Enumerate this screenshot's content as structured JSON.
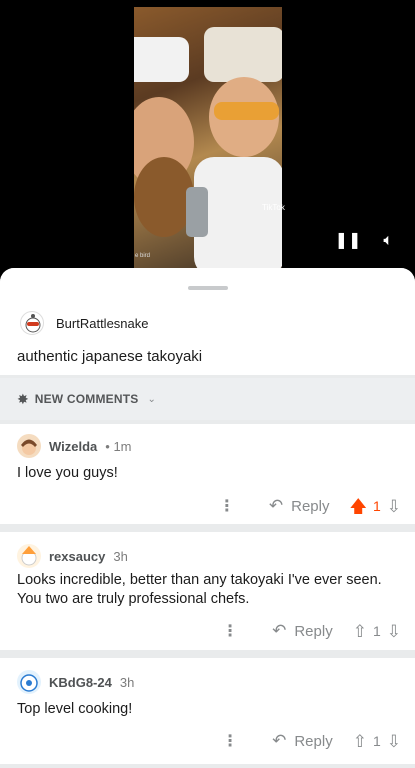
{
  "video": {
    "watermark": "TikTok",
    "cam_tag": "e bird",
    "pause_icon": "pause-icon",
    "volume_icon": "volume-icon"
  },
  "post": {
    "author": "BurtRattlesnake",
    "title": "authentic japanese takoyaki"
  },
  "new_comments": {
    "label": "NEW COMMENTS"
  },
  "comments": [
    {
      "user": "Wizelda",
      "time": "• 1m",
      "body": "I love you guys!",
      "reply_label": "Reply",
      "votes": "1",
      "upvoted": true
    },
    {
      "user": "rexsaucy",
      "time": "3h",
      "body": "Looks incredible, better than any takoyaki I've ever seen. You two are truly professional chefs.",
      "reply_label": "Reply",
      "votes": "1",
      "upvoted": false
    },
    {
      "user": "KBdG8-24",
      "time": "3h",
      "body": "Top level cooking!",
      "reply_label": "Reply",
      "votes": "1",
      "upvoted": false
    }
  ],
  "colors": {
    "upvote_active": "#ff4500",
    "muted": "#878a8c"
  }
}
